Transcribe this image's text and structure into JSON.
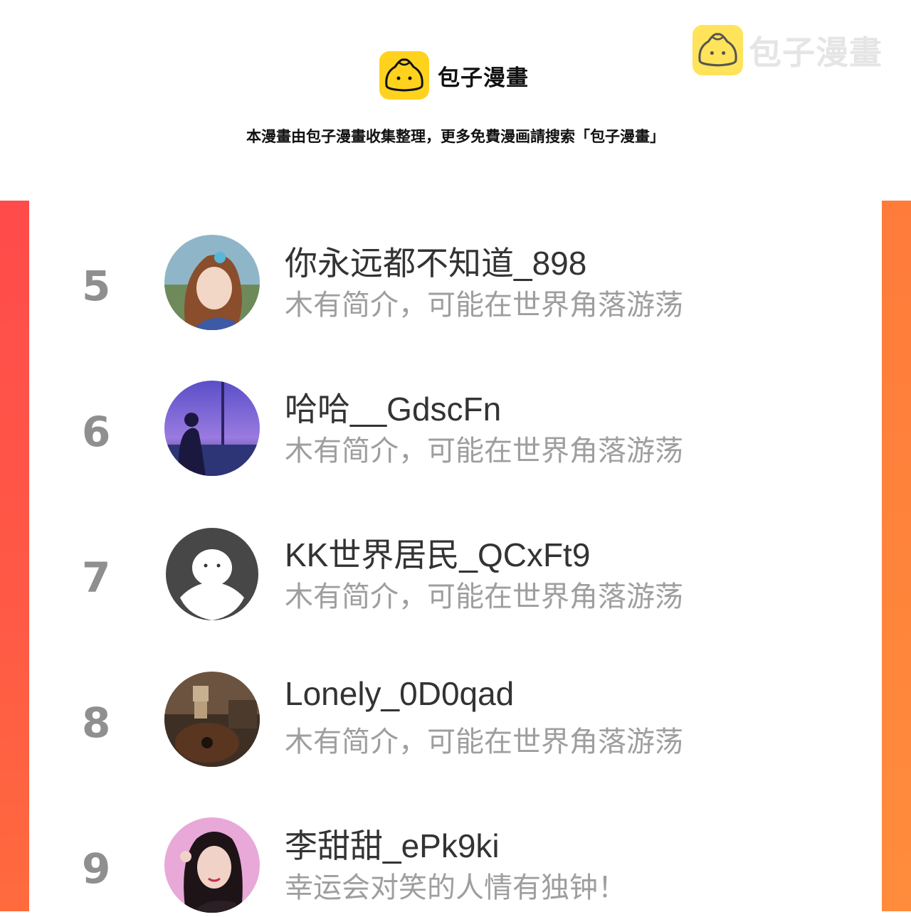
{
  "brand": {
    "name": "包子漫畫",
    "watermark": "包子漫畫"
  },
  "notice": "本漫畫由包子漫畫收集整理，更多免費漫画請搜索「包子漫畫」",
  "colors": {
    "strip_left": "#ff4b4b",
    "strip_right": "#ff8a3c",
    "bun_yellow": "#ffd21e"
  },
  "rows": [
    {
      "rank": "5",
      "name": "你永远都不知道_898",
      "bio": "木有简介，可能在世界角落游荡",
      "avatar": "anime-girl-avatar"
    },
    {
      "rank": "6",
      "name": "哈哈__GdscFn",
      "bio": "木有简介，可能在世界角落游荡",
      "avatar": "night-city-avatar"
    },
    {
      "rank": "7",
      "name": "KK世界居民_QCxFt9",
      "bio": "木有简介，可能在世界角落游荡",
      "avatar": "default-ghost-avatar"
    },
    {
      "rank": "8",
      "name": "Lonely_0D0qad",
      "bio": "木有简介，可能在世界角落游荡",
      "avatar": "danbo-guitar-avatar"
    },
    {
      "rank": "9",
      "name": "李甜甜_ePk9ki",
      "bio": "幸运会对笑的人情有独钟！",
      "avatar": "girl-photo-avatar"
    }
  ]
}
